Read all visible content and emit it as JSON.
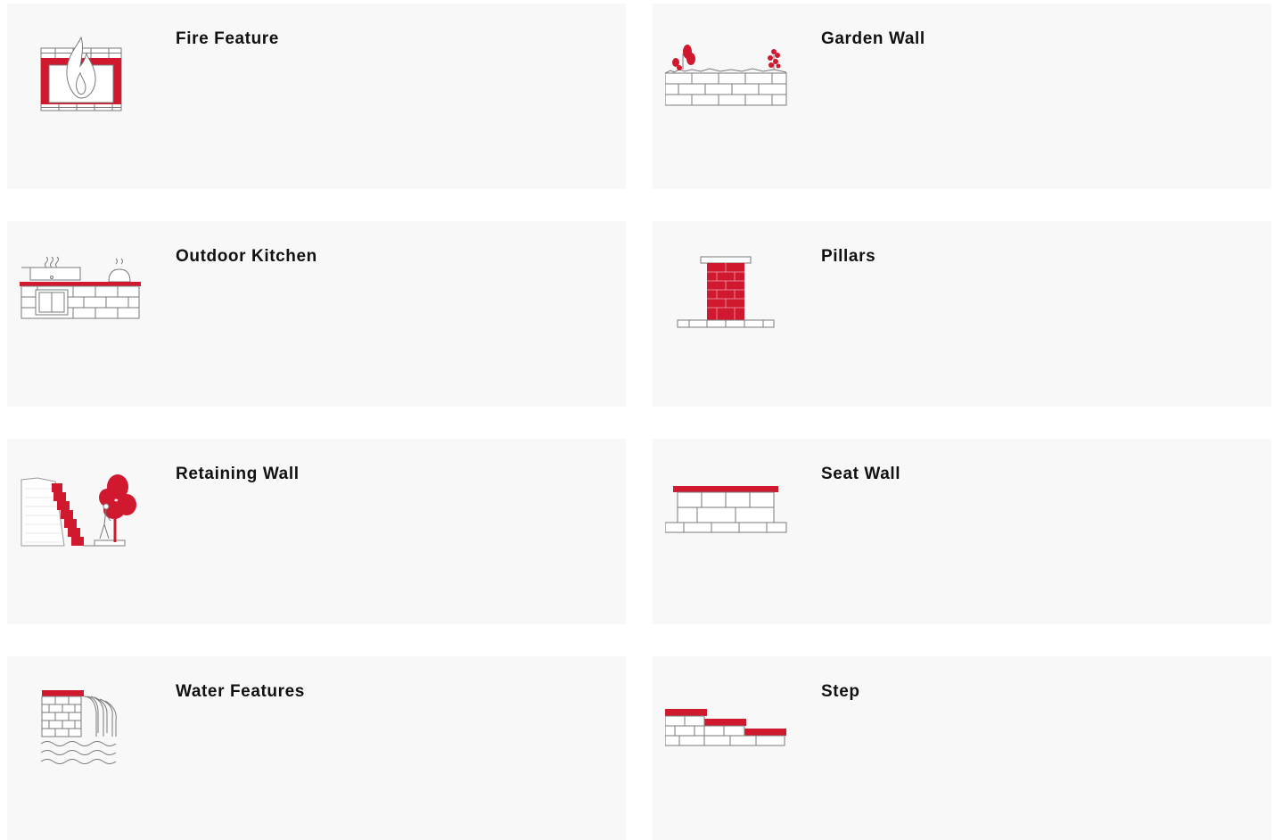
{
  "colors": {
    "card_background": "#f8f8f8",
    "accent_red": "#d0182f",
    "line_gray": "#7a7a7a",
    "title_text": "#111111"
  },
  "cards": [
    {
      "title": "Fire Feature",
      "icon": "fire-feature-icon"
    },
    {
      "title": "Garden Wall",
      "icon": "garden-wall-icon"
    },
    {
      "title": "Outdoor Kitchen",
      "icon": "outdoor-kitchen-icon"
    },
    {
      "title": "Pillars",
      "icon": "pillars-icon"
    },
    {
      "title": "Retaining Wall",
      "icon": "retaining-wall-icon"
    },
    {
      "title": "Seat Wall",
      "icon": "seat-wall-icon"
    },
    {
      "title": "Water Features",
      "icon": "water-features-icon"
    },
    {
      "title": "Step",
      "icon": "step-icon"
    }
  ]
}
